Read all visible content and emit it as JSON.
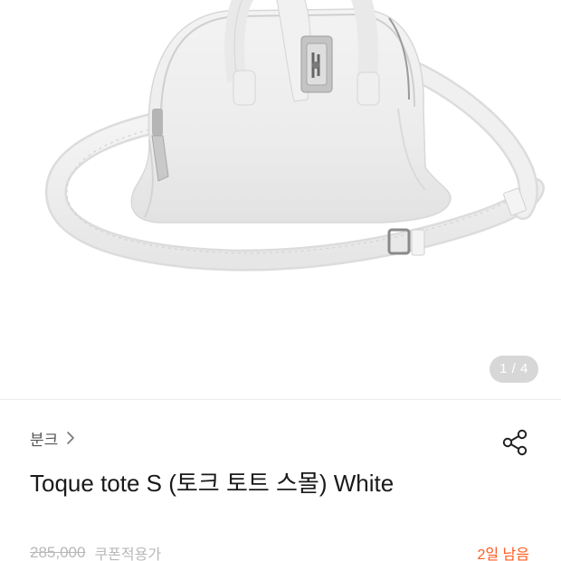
{
  "gallery": {
    "image_alt": "Toque tote S white leather bag",
    "counter": "1 / 4"
  },
  "product": {
    "brand": "분크",
    "title": "Toque tote S (토크 토트 스몰) White",
    "original_price": "285,000",
    "coupon_label": "쿠폰적용가",
    "days_left": "2일 남음"
  },
  "icons": {
    "brand_chevron": "chevron-right-icon",
    "share": "share-icon"
  },
  "colors": {
    "accent": "#ff5a1f",
    "muted_text": "#b8b8b8",
    "counter_bg": "#d7d7d7"
  }
}
